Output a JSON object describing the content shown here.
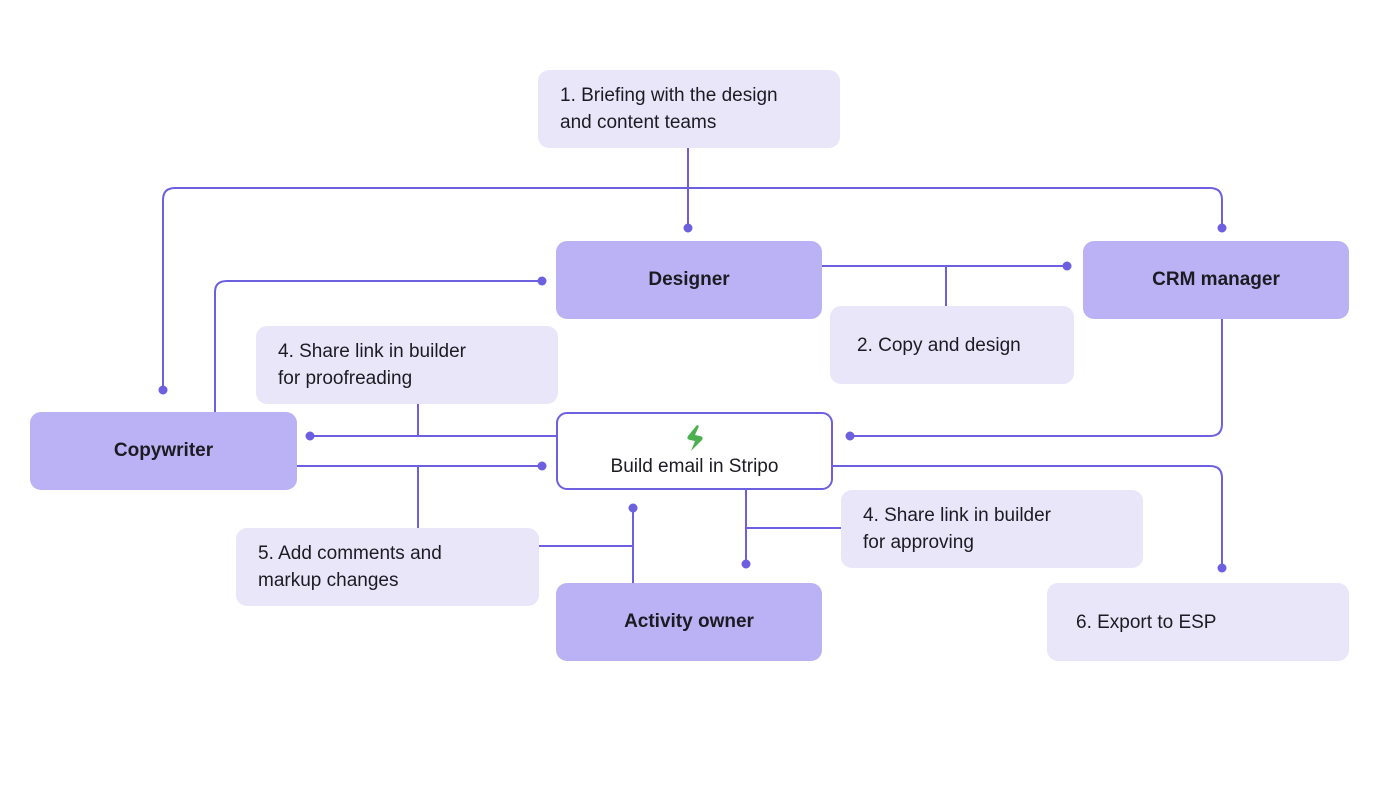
{
  "colors": {
    "connector": "#6c5fe0",
    "role_fill": "#bbb2f5",
    "step_fill": "#e9e6fa",
    "logo": "#4caf50"
  },
  "roles": {
    "designer": "Designer",
    "crm_manager": "CRM manager",
    "copywriter": "Copywriter",
    "activity_owner": "Activity owner"
  },
  "center": {
    "label": "Build email in Stripo",
    "icon": "stripo-logo-icon"
  },
  "steps": {
    "briefing": "1. Briefing with the design\n    and content teams",
    "copy_design": "2. Copy and design",
    "share_proofreading": " 4. Share link in builder\nfor proofreading",
    "share_approving": " 4. Share link in builder\nfor approving",
    "add_comments": " 5. Add comments and\nmarkup changes",
    "export": "6. Export to ESP"
  }
}
